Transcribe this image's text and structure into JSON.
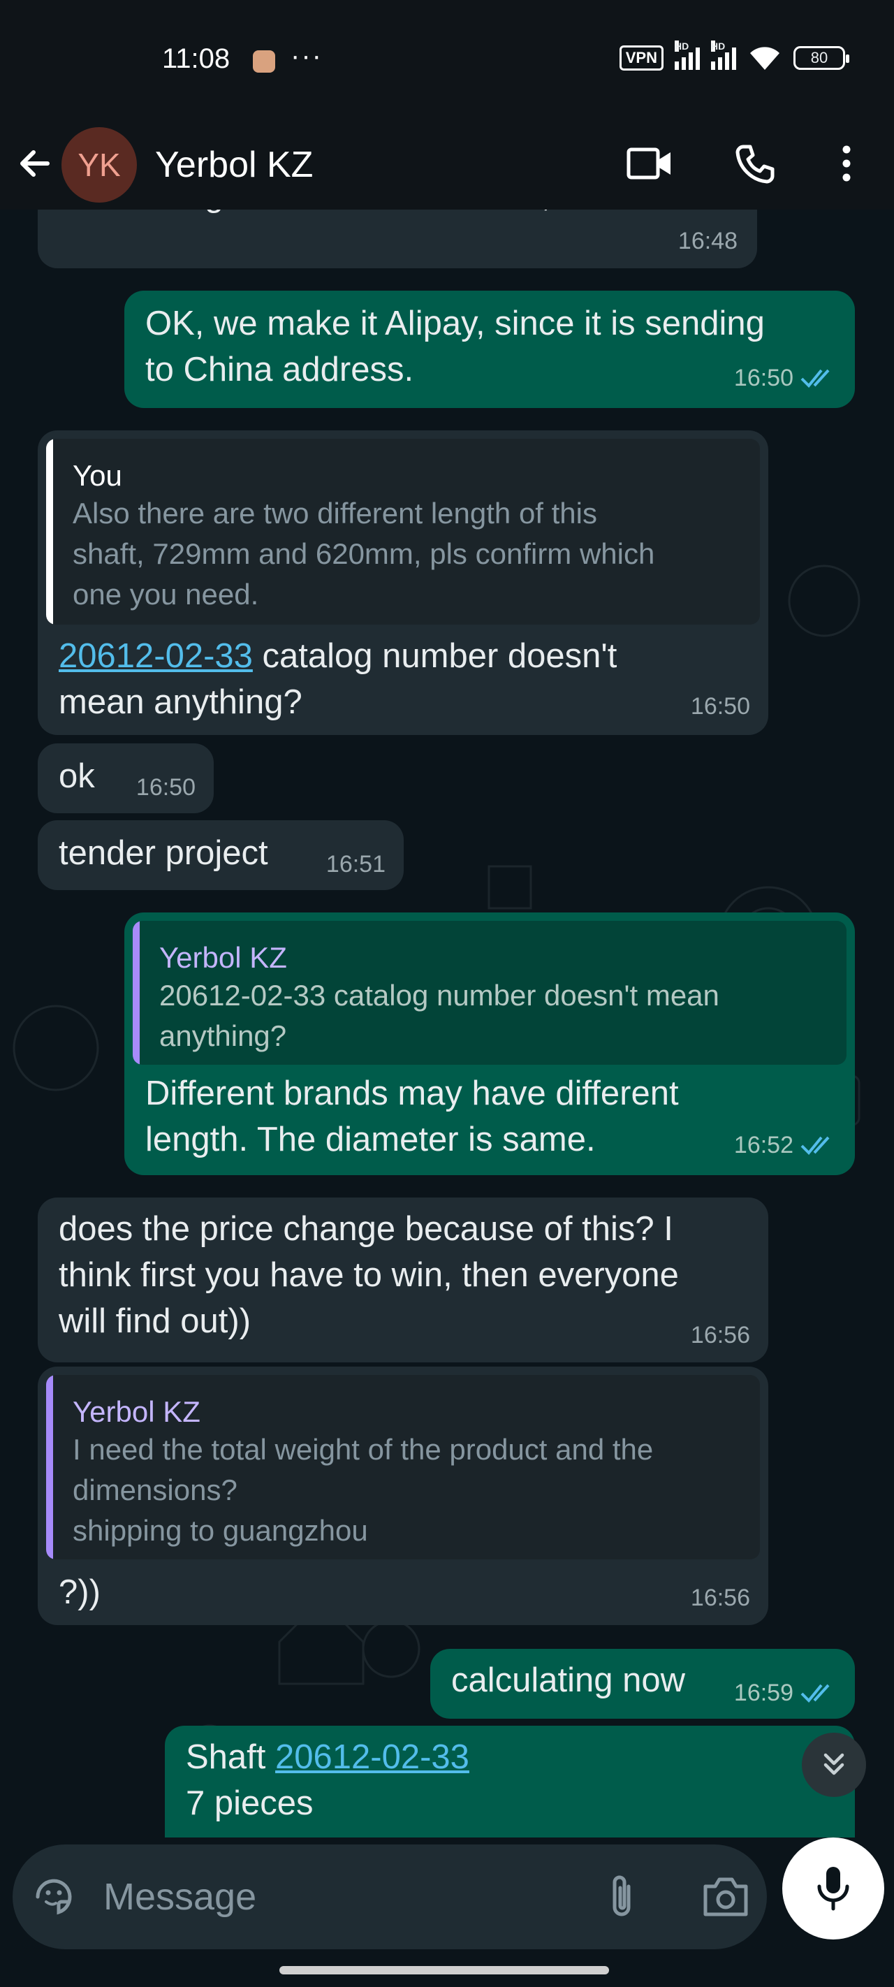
{
  "status_bar": {
    "time": "11:08",
    "more": "···",
    "vpn": "VPN",
    "hd1": "HD",
    "hd2": "HD",
    "battery": "80"
  },
  "header": {
    "avatar_initials": "YK",
    "contact_name": "Yerbol KZ"
  },
  "messages": [
    {
      "dir": "in",
      "text_cut": "and through Kazakhstan dollars, take two",
      "time": "16:48"
    },
    {
      "dir": "out",
      "line1": "OK, we make it Alipay, since it is sending",
      "line2": "to China address.",
      "time": "16:50"
    },
    {
      "dir": "in",
      "quote_name": "You",
      "quote_line1": "Also there are two different length of this",
      "quote_line2": "shaft, 729mm and 620mm, pls confirm which",
      "quote_line3": "one you need.",
      "link": "20612-02-33",
      "line1_rest": " catalog number doesn't",
      "line2": "mean anything?",
      "time": "16:50"
    },
    {
      "dir": "in",
      "text": "ok",
      "time": "16:50"
    },
    {
      "dir": "in",
      "text": "tender project",
      "time": "16:51"
    },
    {
      "dir": "out",
      "quote_name": "Yerbol KZ",
      "quote_line1": "20612-02-33 catalog number doesn't mean",
      "quote_line2": "anything?",
      "line1": "Different brands may have different",
      "line2": "length. The diameter is same.",
      "time": "16:52"
    },
    {
      "dir": "in",
      "line1": "does the price change because of this? I",
      "line2": "think first you have to win, then everyone",
      "line3": "will find out))",
      "time": "16:56"
    },
    {
      "dir": "in",
      "quote_name": "Yerbol KZ",
      "quote_line1": "I need the total weight of the product and the",
      "quote_line2": "dimensions?",
      "quote_line3": "shipping to guangzhou",
      "text": "?))",
      "time": "16:56"
    },
    {
      "dir": "out",
      "text": "calculating now",
      "time": "16:59"
    },
    {
      "dir": "out",
      "prefix": "Shaft ",
      "link": "20612-02-33",
      "line2": "7 pieces"
    }
  ],
  "input": {
    "placeholder": "Message"
  },
  "colors": {
    "background": "#0b141a",
    "incoming_bubble": "#202c33",
    "outgoing_bubble": "#005c4b",
    "link": "#53bdeb",
    "read_ticks": "#53bdeb",
    "quote_you": "#ffffff",
    "quote_contact": "#a78bfa"
  }
}
